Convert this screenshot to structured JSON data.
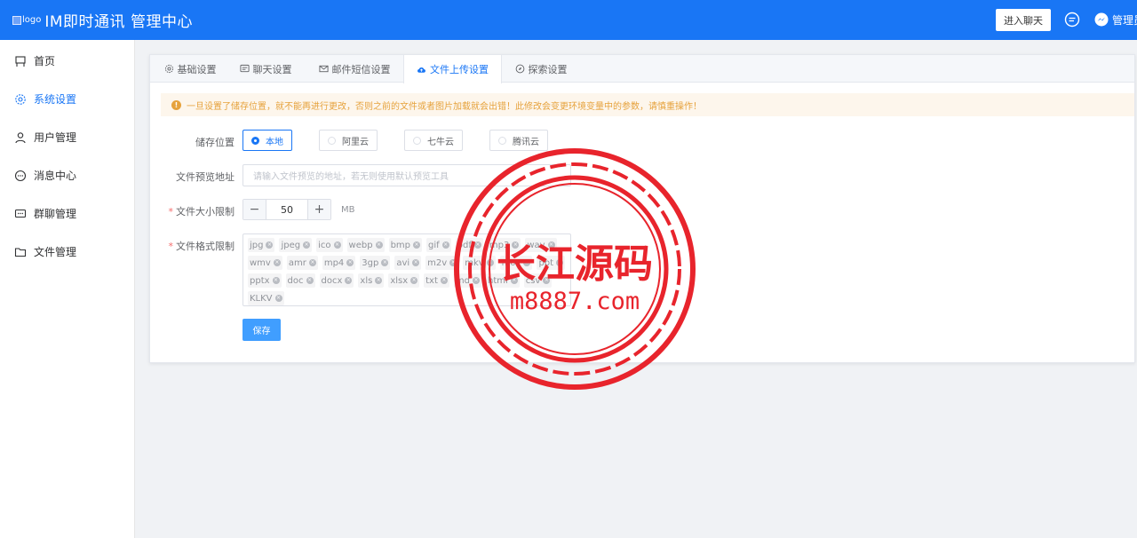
{
  "header": {
    "logo_alt": "logo",
    "title": "IM即时通讯 管理中心",
    "enter_chat_label": "进入聊天",
    "admin_label": "管理员"
  },
  "sidebar": {
    "items": [
      {
        "label": "首页",
        "icon": "flag-icon",
        "active": false
      },
      {
        "label": "系统设置",
        "icon": "gear-icon",
        "active": true
      },
      {
        "label": "用户管理",
        "icon": "user-icon",
        "active": false
      },
      {
        "label": "消息中心",
        "icon": "chat-bubble-icon",
        "active": false
      },
      {
        "label": "群聊管理",
        "icon": "group-chat-icon",
        "active": false
      },
      {
        "label": "文件管理",
        "icon": "folder-icon",
        "active": false
      }
    ]
  },
  "tabs": [
    {
      "label": "基础设置",
      "icon": "gear-icon",
      "active": false
    },
    {
      "label": "聊天设置",
      "icon": "message-icon",
      "active": false
    },
    {
      "label": "邮件短信设置",
      "icon": "mail-icon",
      "active": false
    },
    {
      "label": "文件上传设置",
      "icon": "cloud-upload-icon",
      "active": true
    },
    {
      "label": "探索设置",
      "icon": "compass-icon",
      "active": false
    }
  ],
  "alert": {
    "text": "一旦设置了储存位置，就不能再进行更改，否则之前的文件或者图片加载就会出错！此修改会变更环境变量中的参数，请慎重操作！",
    "color": "#e6a23c"
  },
  "form": {
    "storage": {
      "label": "储存位置",
      "options": [
        "本地",
        "阿里云",
        "七牛云",
        "腾讯云"
      ],
      "selected": "本地"
    },
    "preview": {
      "label": "文件预览地址",
      "placeholder": "请输入文件预览的地址，若无则使用默认预览工具"
    },
    "size_limit": {
      "label": "文件大小限制",
      "value": "50",
      "minus": "−",
      "plus": "+",
      "unit": "MB"
    },
    "format_limit": {
      "label": "文件格式限制",
      "tags": [
        "jpg",
        "jpeg",
        "ico",
        "webp",
        "bmp",
        "gif",
        "pdf",
        "mp3",
        "wav",
        "wmv",
        "amr",
        "mp4",
        "3gp",
        "avi",
        "m2v",
        "mkv",
        "mov",
        "ppt",
        "pptx",
        "doc",
        "docx",
        "xls",
        "xlsx",
        "txt",
        "md",
        "html",
        "csv",
        "KLKV"
      ]
    },
    "save_label": "保存"
  },
  "watermark": {
    "text": "长江源码",
    "url": "m8887.com",
    "color": "#e8242c"
  },
  "colors": {
    "primary": "#1976f5",
    "button": "#409eff",
    "warning": "#e6a23c"
  }
}
